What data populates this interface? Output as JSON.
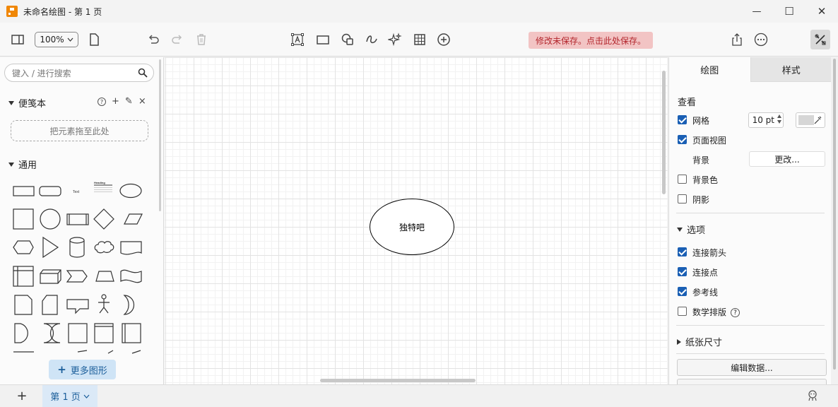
{
  "window": {
    "title": "未命名绘图 - 第 1 页",
    "min_symbol": "—",
    "max_symbol": "☐",
    "close_symbol": "✕"
  },
  "toolbar": {
    "zoom": "100%",
    "unsaved_notice": "修改未保存。点击此处保存。",
    "icons": [
      "sidebar-toggle-icon",
      "page-icon",
      "undo-icon",
      "redo-icon",
      "trash-icon",
      "text-icon",
      "rectangle-icon",
      "shapes-icon",
      "freehand-icon",
      "sparkle-icon",
      "table-icon",
      "insert-icon",
      "share-icon",
      "more-icon",
      "tools-icon"
    ]
  },
  "sidebar": {
    "search_placeholder": "键入 / 进行搜索",
    "scratchpad": {
      "title": "便笺本",
      "help": "?",
      "add": "+",
      "edit": "✎",
      "close": "×",
      "dropzone": "把元素拖至此处"
    },
    "general": {
      "title": "通用",
      "text_shape_label": "Text",
      "heading_shape_label": "Heading"
    },
    "more_shapes": "更多图形",
    "more_plus": "+"
  },
  "canvas": {
    "ellipse_label": "独特吧"
  },
  "format_panel": {
    "tabs": [
      "绘图",
      "样式"
    ],
    "view_title": "查看",
    "grid_label": "网格",
    "grid_size": "10 pt",
    "grid_checked": true,
    "page_view_label": "页面视图",
    "page_view_checked": true,
    "background_label": "背景",
    "change_button": "更改...",
    "background_color_label": "背景色",
    "background_color_checked": false,
    "shadow_label": "阴影",
    "shadow_checked": false,
    "options_title": "选项",
    "connection_arrows_label": "连接箭头",
    "connection_arrows_checked": true,
    "connection_points_label": "连接点",
    "connection_points_checked": true,
    "guides_label": "参考线",
    "guides_checked": true,
    "math_label": "数学排版",
    "math_checked": false,
    "help": "?",
    "paper_size_title": "纸张尺寸",
    "edit_data_button": "编辑数据...",
    "accent_color": "#1a5fb4"
  },
  "footer": {
    "add": "+",
    "page_tab": "第 1 页"
  }
}
